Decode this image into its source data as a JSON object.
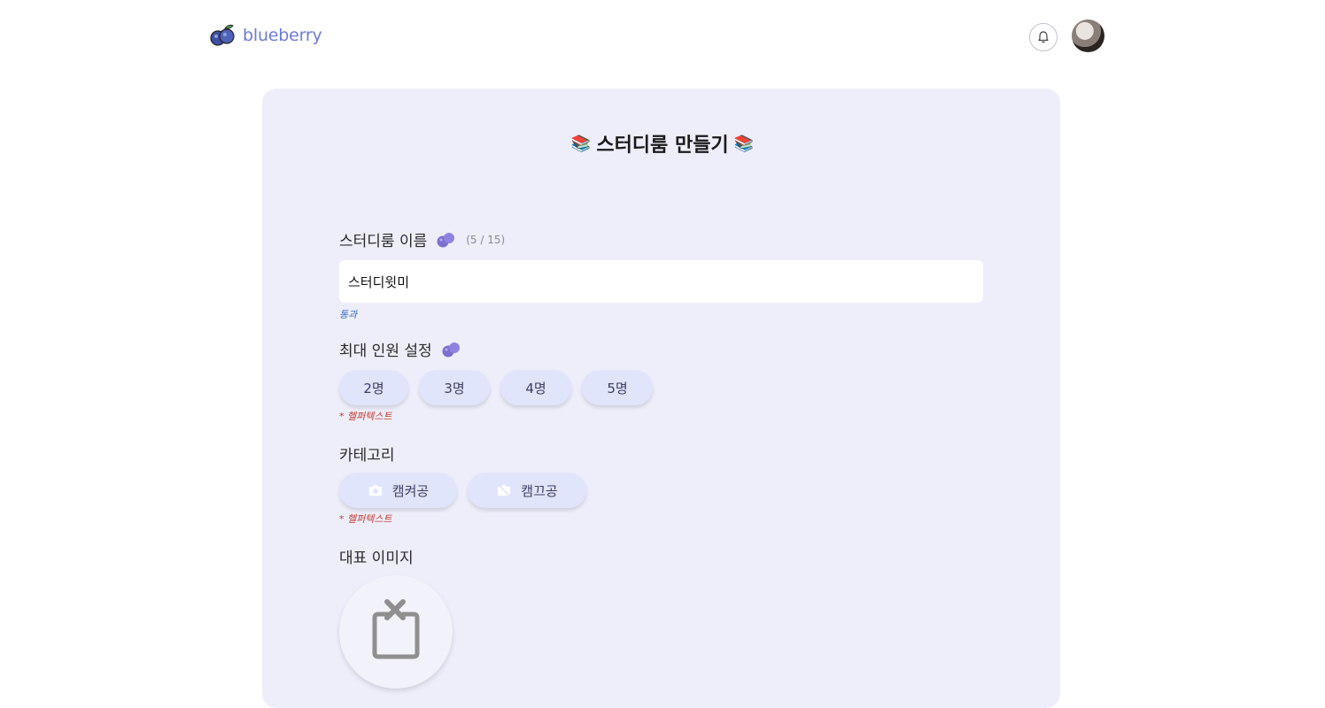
{
  "header": {
    "brand": "blueberry"
  },
  "form": {
    "title": "스터디룸 만들기",
    "title_emoji": "📚",
    "name": {
      "label": "스터디룸 이름",
      "counter": "(5 / 15)",
      "value": "스터디윗미",
      "helper": "통과"
    },
    "capacity": {
      "label": "최대 인원 설정",
      "options": [
        "2명",
        "3명",
        "4명",
        "5명"
      ],
      "helper": "* 헬퍼텍스트"
    },
    "category": {
      "label": "카테고리",
      "options": [
        {
          "label": "캠켜공",
          "icon": "camera-icon"
        },
        {
          "label": "캠끄공",
          "icon": "camera-off-icon"
        }
      ],
      "helper": "* 헬퍼텍스트"
    },
    "image": {
      "label": "대표 이미지"
    }
  },
  "colors": {
    "brand": "#6c7bd6",
    "card_bg": "#eeeefb",
    "pill_bg": "#e1e5fb",
    "helper_ok": "#3a6ec7",
    "helper_warn": "#c0392b"
  }
}
